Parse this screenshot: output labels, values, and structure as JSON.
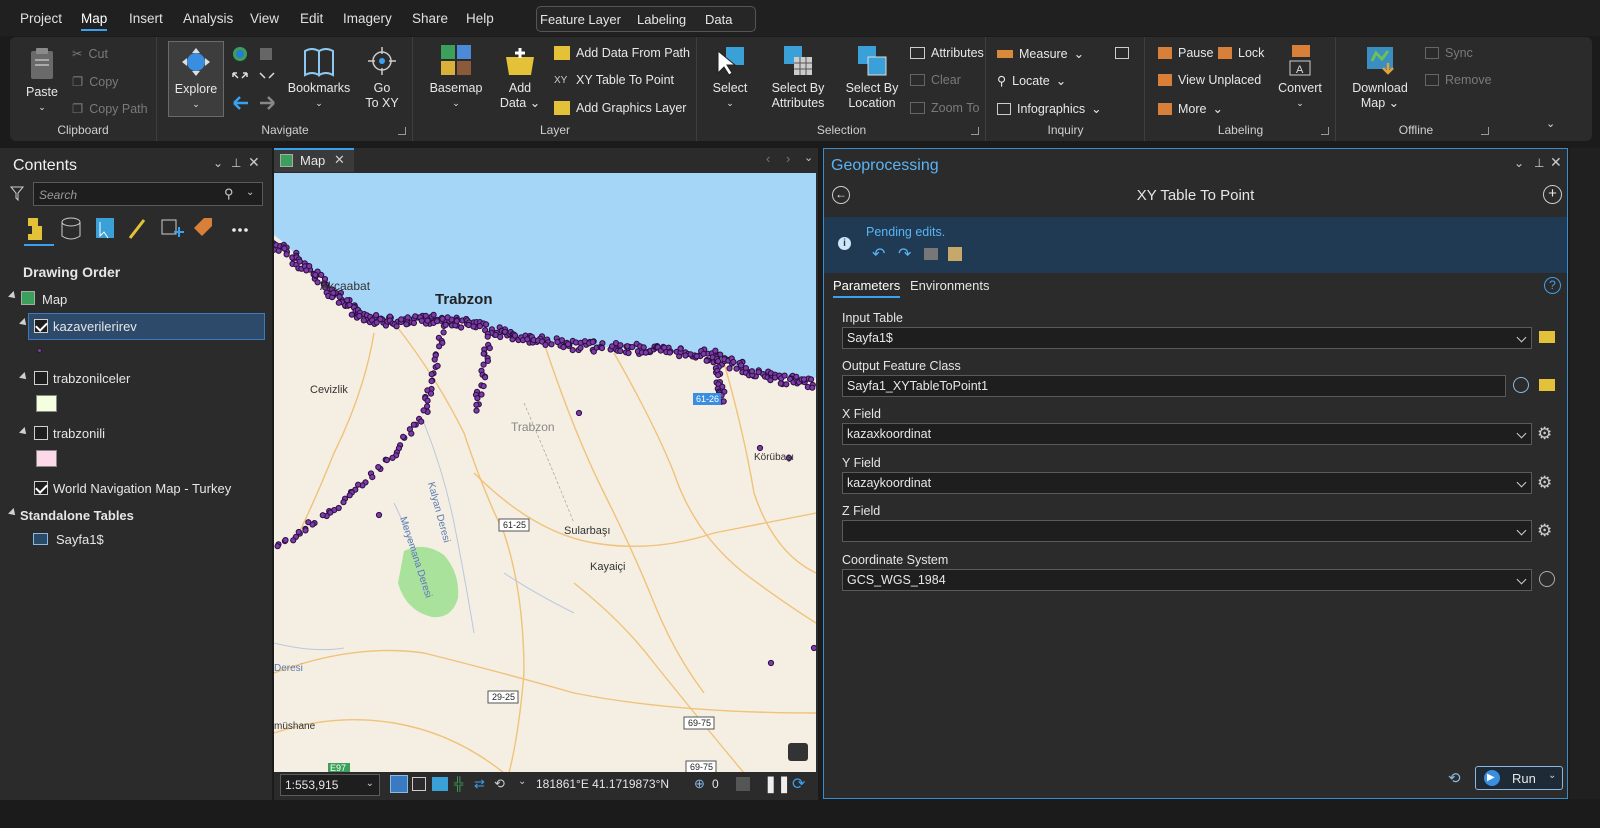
{
  "menu": {
    "items": [
      "Project",
      "Map",
      "Insert",
      "Analysis",
      "View",
      "Edit",
      "Imagery",
      "Share",
      "Help"
    ],
    "active": "Map",
    "contextual": [
      "Feature Layer",
      "Labeling",
      "Data"
    ]
  },
  "ribbon": {
    "clipboard": {
      "paste": "Paste",
      "cut": "Cut",
      "copy": "Copy",
      "copy_path": "Copy Path",
      "label": "Clipboard"
    },
    "navigate": {
      "explore": "Explore",
      "bookmarks": "Bookmarks",
      "goto_line1": "Go",
      "goto_line2": "To XY",
      "label": "Navigate"
    },
    "layer": {
      "basemap": "Basemap",
      "add_data_line1": "Add",
      "add_data_line2": "Data",
      "add_from_path": "Add Data From Path",
      "xy_table": "XY Table To Point",
      "add_graphics": "Add Graphics Layer",
      "label": "Layer"
    },
    "selection": {
      "select": "Select",
      "by_attr_line1": "Select By",
      "by_attr_line2": "Attributes",
      "by_loc_line1": "Select By",
      "by_loc_line2": "Location",
      "attributes": "Attributes",
      "clear": "Clear",
      "zoom_to": "Zoom To",
      "label": "Selection"
    },
    "inquiry": {
      "measure": "Measure",
      "locate": "Locate",
      "infographics": "Infographics",
      "label": "Inquiry"
    },
    "labeling": {
      "pause": "Pause",
      "lock": "Lock",
      "view_unplaced": "View Unplaced",
      "more": "More",
      "convert": "Convert",
      "label": "Labeling"
    },
    "offline": {
      "download_line1": "Download",
      "download_line2": "Map",
      "sync": "Sync",
      "remove": "Remove",
      "label": "Offline"
    }
  },
  "contents": {
    "title": "Contents",
    "search_placeholder": "Search",
    "drawing_order": "Drawing Order",
    "map": "Map",
    "layers": [
      {
        "name": "kazaverilerirev",
        "checked": true
      },
      {
        "name": "trabzonilceler",
        "checked": false
      },
      {
        "name": "trabzonili",
        "checked": false
      },
      {
        "name": "World Navigation Map - Turkey",
        "checked": true
      }
    ],
    "standalone": "Standalone Tables",
    "table": "Sayfa1$"
  },
  "map": {
    "tab": "Map",
    "labels": {
      "akcaabat": "Akçaabat",
      "trabzon_city": "Trabzon",
      "cevizlik": "Cevizlik",
      "trabzon_region": "Trabzon",
      "korubasi": "Körübaşı",
      "sularbasi": "Sularbaşı",
      "kayaici": "Kayaiçi",
      "kalyan": "Kalyan Deresi",
      "meryemana": "Meryemana Deresi",
      "deresi": "Deresi",
      "gumushane": "müshane",
      "e97": "E97",
      "road_6126": "61-26",
      "road_6125": "61-25",
      "road_2925": "29-25",
      "road_6975": "69-75",
      "road_6975b": "69-75"
    },
    "scale": "1:553,915",
    "coords": "181861°E 41.1719873°N",
    "selected_count": "0"
  },
  "geo": {
    "title": "Geoprocessing",
    "tool": "XY Table To Point",
    "pending": "Pending edits.",
    "tabs": [
      "Parameters",
      "Environments"
    ],
    "fields": [
      {
        "label": "Input Table",
        "value": "Sayfa1$"
      },
      {
        "label": "Output Feature Class",
        "value": "Sayfa1_XYTableToPoint1"
      },
      {
        "label": "X Field",
        "value": "kazaxkoordinat"
      },
      {
        "label": "Y Field",
        "value": "kazaykoordinat"
      },
      {
        "label": "Z Field",
        "value": ""
      },
      {
        "label": "Coordinate System",
        "value": "GCS_WGS_1984"
      }
    ],
    "run": "Run"
  },
  "colors": {
    "accent": "#3aa0f0",
    "sea": "#a6d6f7",
    "land": "#f5efe3",
    "points": "#7d3aa8",
    "road": "#f0c27a"
  }
}
